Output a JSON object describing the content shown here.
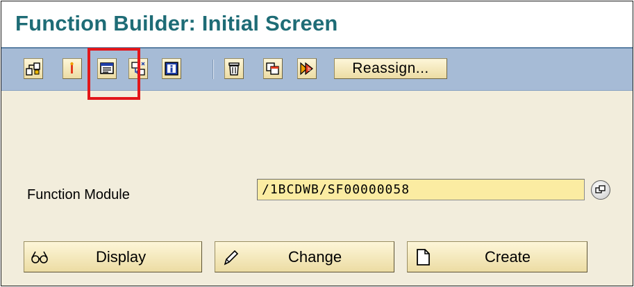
{
  "window": {
    "title": "Function Builder: Initial Screen"
  },
  "toolbar": {
    "icons": [
      "other-object-icon",
      "where-used-icon",
      "test-execute-icon",
      "copy-icon",
      "information-icon",
      "delete-icon",
      "duplicate-icon",
      "rename-icon"
    ],
    "reassign_label": "Reassign..."
  },
  "form": {
    "function_module_label": "Function Module",
    "function_module_value": "/1BCDWB/SF00000058",
    "help_icon": "possible-entries-icon"
  },
  "actions": {
    "display_label": "Display",
    "change_label": "Change",
    "create_label": "Create"
  },
  "colors": {
    "title": "#1e6c76",
    "toolbar": "#a6bbd6",
    "input_bg": "#fbeca2",
    "button_bg": "#ecdca3",
    "highlight": "#e3161a"
  }
}
